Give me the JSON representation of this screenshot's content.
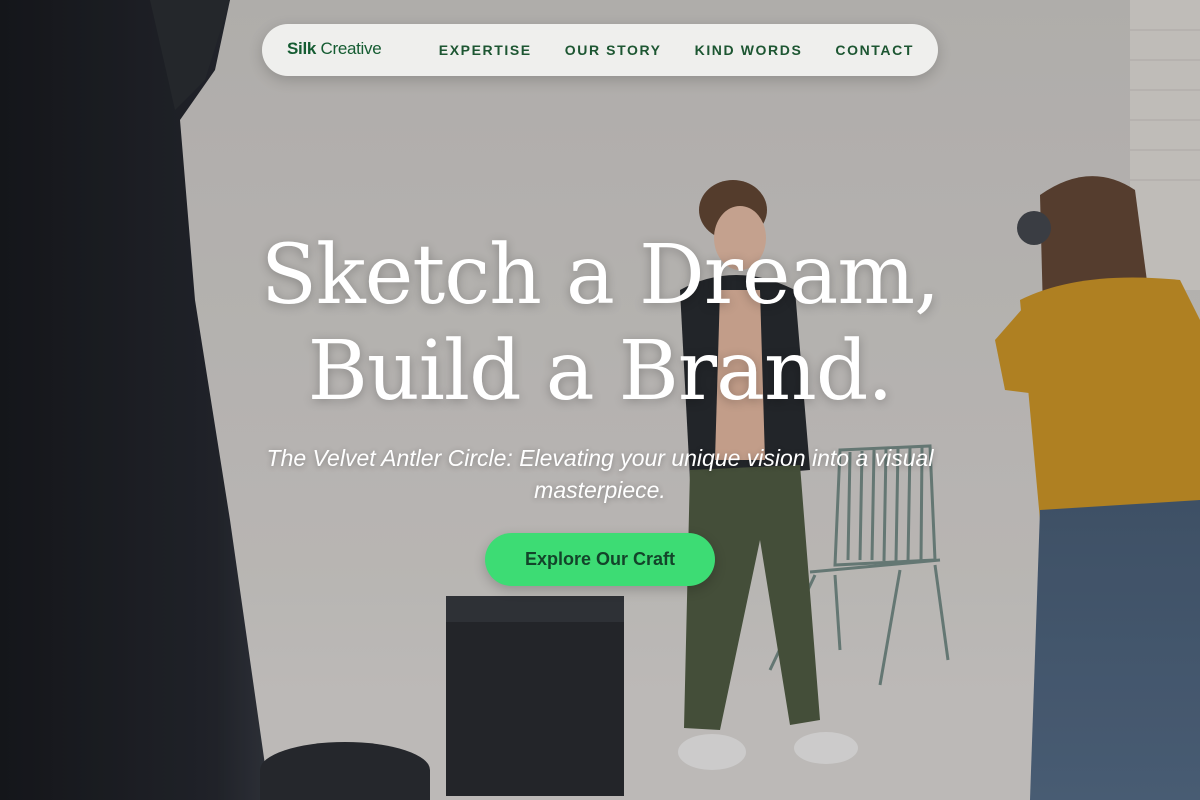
{
  "nav": {
    "brand_bold": "Silk",
    "brand_rest": "Creative",
    "links": [
      "EXPERTISE",
      "OUR STORY",
      "KIND WORDS",
      "CONTACT"
    ]
  },
  "hero": {
    "title_line1": "Sketch a Dream,",
    "title_line2": "Build a Brand.",
    "subtitle": "The Velvet Antler Circle: Elevating your unique vision into a visual masterpiece.",
    "cta_label": "Explore Our Craft"
  },
  "colors": {
    "accent": "#3ddc74",
    "brand_green": "#155c32",
    "nav_text": "#1d5632"
  }
}
